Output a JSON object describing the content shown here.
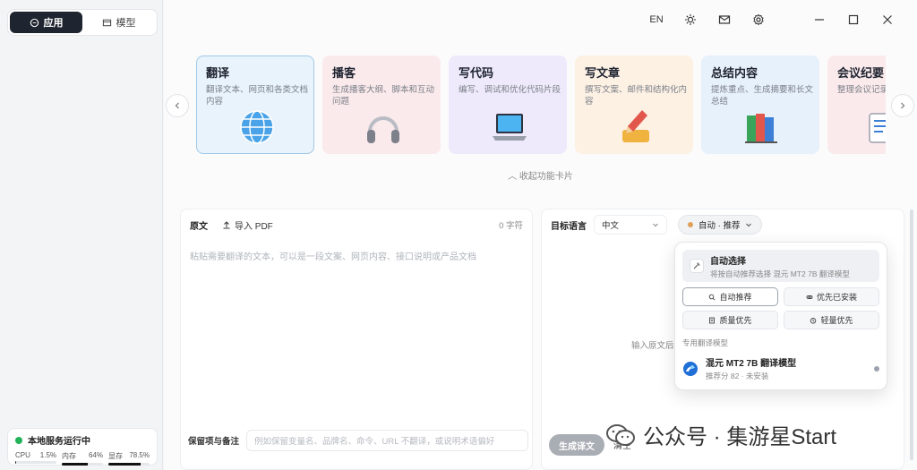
{
  "sidebar": {
    "tabs": [
      {
        "label": "应用",
        "icon": "chat-icon",
        "active": true
      },
      {
        "label": "模型",
        "icon": "box-icon",
        "active": false
      }
    ],
    "status": {
      "title": "本地服务运行中",
      "metrics": [
        {
          "label": "CPU",
          "value": "1.5%",
          "percent": 1.5
        },
        {
          "label": "内存",
          "value": "64%",
          "percent": 64
        },
        {
          "label": "显存",
          "value": "78.5%",
          "percent": 78.5
        }
      ]
    }
  },
  "titlebar": {
    "lang": "EN",
    "icons": [
      "sun-icon",
      "mail-icon",
      "gear-icon",
      "minimize-icon",
      "maximize-icon",
      "close-icon"
    ]
  },
  "cards": [
    {
      "title": "翻译",
      "desc": "翻译文本、网页和各类文档内容",
      "icon": "globe-icon",
      "bg": "#e8f3fb",
      "border": "#9fc9e8"
    },
    {
      "title": "播客",
      "desc": "生成播客大纲、脚本和互动问题",
      "icon": "headphones-icon",
      "bg": "#fbeaec",
      "border": "transparent"
    },
    {
      "title": "写代码",
      "desc": "编写、调试和优化代码片段",
      "icon": "laptop-icon",
      "bg": "#efeafb",
      "border": "transparent"
    },
    {
      "title": "写文章",
      "desc": "撰写文案、邮件和结构化内容",
      "icon": "pencil-icon",
      "bg": "#fdf1e4",
      "border": "transparent"
    },
    {
      "title": "总结内容",
      "desc": "提炼重点、生成摘要和长文总结",
      "icon": "books-icon",
      "bg": "#e7f1fb",
      "border": "transparent"
    },
    {
      "title": "会议纪要",
      "desc": "整理会议记录和行动项",
      "icon": "notes-icon",
      "bg": "#fbeaec",
      "border": "transparent"
    }
  ],
  "collapse_label": "收起功能卡片",
  "source": {
    "label": "原文",
    "import_label": "导入 PDF",
    "char_count": "0 字符",
    "placeholder": "粘贴需要翻译的文本，可以是一段文案、网页内容、接口说明或产品文档",
    "notes_label": "保留项与备注",
    "notes_placeholder": "例如保留变量名、品牌名、命令、URL 不翻译，或说明术语偏好"
  },
  "target": {
    "label": "目标语言",
    "language": "中文",
    "mode_label": "自动 · 推荐",
    "output_hint": "输入原文后",
    "generate_label": "生成译文",
    "clear_label": "清空"
  },
  "dropdown": {
    "auto_title": "自动选择",
    "auto_desc": "将按自动推荐选择 混元 MT2 7B 翻译模型",
    "options": [
      {
        "label": "自动推荐",
        "icon": "search-icon",
        "selected": true
      },
      {
        "label": "优先已安装",
        "icon": "link-icon",
        "selected": false
      },
      {
        "label": "质量优先",
        "icon": "doc-icon",
        "selected": false
      },
      {
        "label": "轻量优先",
        "icon": "lightning-icon",
        "selected": false
      }
    ],
    "section_label": "专用翻译模型",
    "model": {
      "name": "混元 MT2 7B 翻译模型",
      "sub": "推荐分 82 · 未安装"
    }
  },
  "watermark": "公众号 · 集游星Start"
}
